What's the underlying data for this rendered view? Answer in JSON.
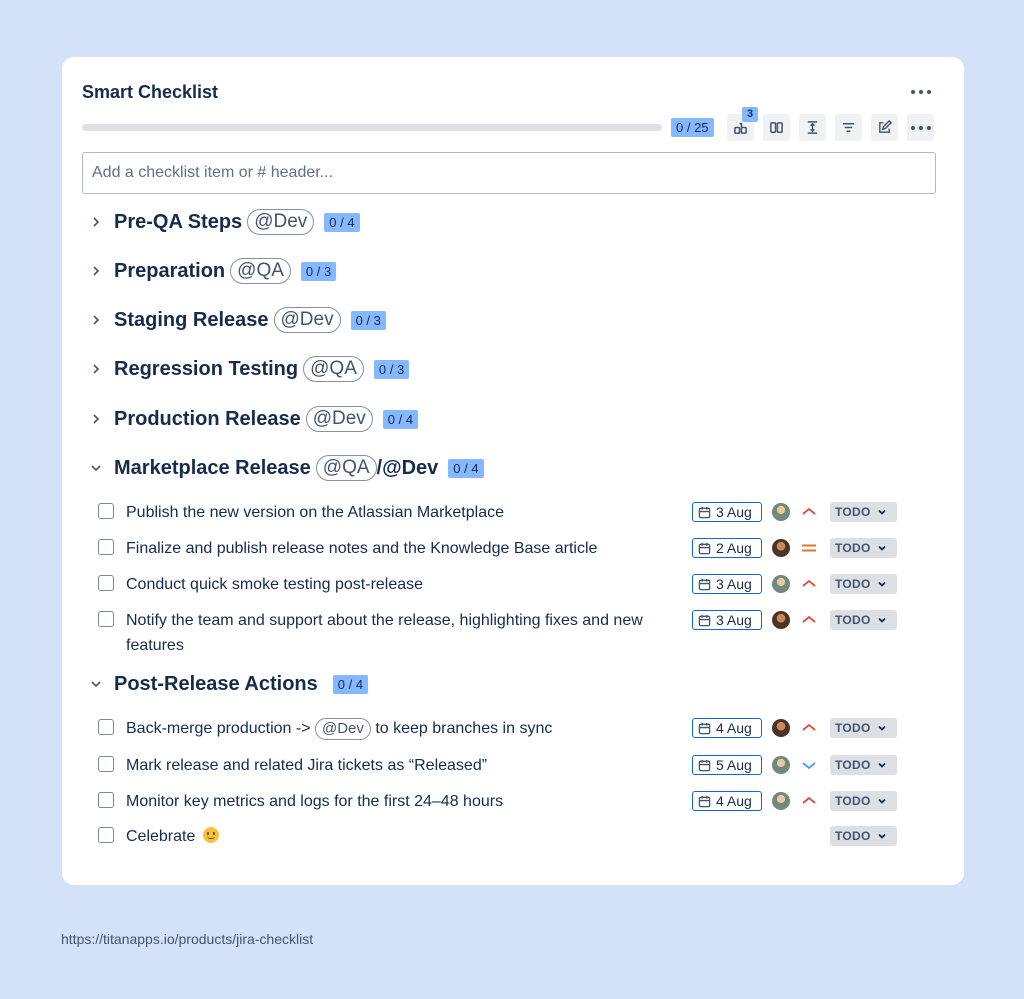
{
  "card": {
    "title": "Smart Checklist",
    "progress": {
      "done": 0,
      "total": 25,
      "label": "0 / 25",
      "fraction": 0
    },
    "toolbar": {
      "badge_count": "3",
      "buttons": [
        "hierarchy-icon",
        "columns-icon",
        "expand-icon",
        "filter-icon",
        "edit-icon",
        "more-icon"
      ]
    },
    "add_placeholder": "Add a checklist item or # header..."
  },
  "sections": [
    {
      "title": "Pre-QA Steps",
      "mention": "@Dev",
      "count": "0 / 4",
      "expanded": false
    },
    {
      "title": "Preparation",
      "mention": "@QA",
      "count": "0 / 3",
      "expanded": false
    },
    {
      "title": "Staging Release",
      "mention": "@Dev",
      "count": "0 / 3",
      "expanded": false
    },
    {
      "title": "Regression Testing",
      "mention": "@QA",
      "count": "0 / 3",
      "expanded": false
    },
    {
      "title": "Production Release",
      "mention": "@Dev",
      "count": "0 / 4",
      "expanded": false
    },
    {
      "title": "Marketplace Release",
      "mention": "@QA",
      "mention_suffix": "/@Dev",
      "count": "0 / 4",
      "expanded": true
    },
    {
      "title": "Post-Release Actions",
      "count": "0 / 4",
      "expanded": true
    }
  ],
  "items": [
    {
      "text": "Publish the new version on the Atlassian Marketplace",
      "date": "3 Aug",
      "priority": "high",
      "status": "TODO"
    },
    {
      "text": "Finalize and publish release notes and the Knowledge Base article",
      "date": "2 Aug",
      "priority": "medium",
      "status": "TODO"
    },
    {
      "text": "Conduct quick smoke testing post-release",
      "date": "3 Aug",
      "priority": "high",
      "status": "TODO"
    },
    {
      "text": "Notify the team and support about the release, highlighting fixes and new features",
      "date": "3 Aug",
      "priority": "high",
      "status": "TODO"
    },
    {
      "text_before": "Back-merge production ->",
      "mention": "@Dev",
      "text_after": "to keep branches in sync",
      "date": "4 Aug",
      "priority": "high",
      "status": "TODO"
    },
    {
      "text": "Mark release and related Jira tickets as “Released”",
      "date": "5 Aug",
      "priority": "low",
      "status": "TODO"
    },
    {
      "text": "Monitor key metrics and logs for the first 24–48 hours",
      "date": "4 Aug",
      "priority": "high",
      "status": "TODO"
    },
    {
      "text": "Celebrate",
      "emoji": "slightly-smiling-face",
      "status": "TODO"
    }
  ],
  "colors": {
    "page_bg": "#d3e2f8",
    "badge_bg": "#85b8ff",
    "priority_high": "#e5493a",
    "priority_medium": "#e2742d",
    "priority_low": "#4c9aff",
    "date_border": "#0c66e4"
  },
  "footer": {
    "url": "https://titanapps.io/products/jira-checklist"
  }
}
